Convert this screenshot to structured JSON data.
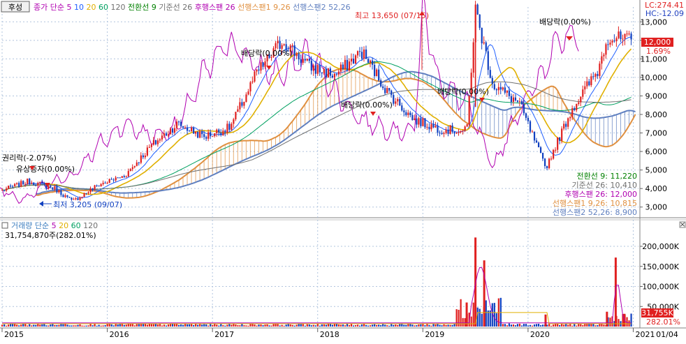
{
  "stock_name": "후성",
  "price_pane": {
    "legend": [
      {
        "text": "종가 단순",
        "color": "#b000b0"
      },
      {
        "text": "5",
        "color": "#b000b0"
      },
      {
        "text": "10",
        "color": "#2060ff"
      },
      {
        "text": "20",
        "color": "#e0b000"
      },
      {
        "text": "60",
        "color": "#00a060"
      },
      {
        "text": "120",
        "color": "#707070"
      },
      {
        "text": "전환선 9",
        "color": "#008000"
      },
      {
        "text": "기준선 26",
        "color": "#707070"
      },
      {
        "text": "후행스팬 26",
        "color": "#b000b0"
      },
      {
        "text": "선행스팬1 9,26",
        "color": "#e09040"
      },
      {
        "text": "선행스팬2 52,26",
        "color": "#6080c0"
      }
    ],
    "lc_text": "LC:274.41",
    "hc_text": "HC:-12.09",
    "price_tag": "12,000",
    "pct_tag": "1.69%",
    "annotations": {
      "high": "최고 13,650 (07/15)",
      "low": "최저 3,205 (09/07)",
      "rights": "권리락(-2.07%)",
      "bonus": "유상증자(0.00%)",
      "div_2017": "배당락(0.00%)",
      "div_2018": "배당락(0.00%)",
      "div_2019": "배당락(0.00%)",
      "div_2020": "배당락(0.00%)"
    },
    "info_box": [
      {
        "text": "전환선 9: 11,220",
        "color": "#008000"
      },
      {
        "text": "기준선 26: 10,410",
        "color": "#707070"
      },
      {
        "text": "후행스팬 26: 12,000",
        "color": "#b000b0"
      },
      {
        "text": "선행스팬1 9,26: 10,815",
        "color": "#e09040"
      },
      {
        "text": "선행스팬2 52,26: 8,900",
        "color": "#6080c0"
      }
    ]
  },
  "volume_pane": {
    "legend": [
      {
        "text": "거래량 단순",
        "color": "#4080c0"
      },
      {
        "text": "5",
        "color": "#b000b0"
      },
      {
        "text": "20",
        "color": "#e0b000"
      },
      {
        "text": "60",
        "color": "#00a060"
      },
      {
        "text": "120",
        "color": "#707070"
      }
    ],
    "last_volume_text": "31,754,870주(282.01%)",
    "vol_tag": "31,755K",
    "vol_pct_tag": "282.01%"
  },
  "x_axis": {
    "years": [
      "2015",
      "2016",
      "2017",
      "2018",
      "2019",
      "2020",
      "2021"
    ],
    "right_label": "01/04"
  },
  "colors": {
    "up": "#e02020",
    "down": "#1040c0",
    "ma5": "#b000b0",
    "ma10": "#2060ff",
    "ma20": "#e0b000",
    "ma60": "#00a060",
    "ma120": "#707070",
    "span1": "#e09040",
    "span2": "#6080c0",
    "grid": "#b0c4de"
  },
  "chart_data": [
    {
      "type": "line",
      "name": "price",
      "x": [
        "2015-01",
        "2015-04",
        "2015-07",
        "2015-09",
        "2015-12",
        "2016-03",
        "2016-06",
        "2016-09",
        "2016-12",
        "2017-03",
        "2017-06",
        "2017-09",
        "2017-12",
        "2018-03",
        "2018-06",
        "2018-09",
        "2018-12",
        "2019-03",
        "2019-06",
        "2019-07",
        "2019-09",
        "2019-12",
        "2020-03",
        "2020-06",
        "2020-09",
        "2020-10",
        "2020-12"
      ],
      "values": [
        3900,
        4400,
        4000,
        3300,
        4200,
        4700,
        6300,
        7500,
        6800,
        7300,
        10200,
        12000,
        10600,
        10100,
        11400,
        9200,
        7700,
        7200,
        7100,
        13650,
        9600,
        8600,
        5100,
        8300,
        10400,
        12200,
        12000
      ],
      "ylim": [
        2500,
        13500
      ],
      "yticks": [
        3000,
        4000,
        5000,
        6000,
        7000,
        8000,
        9000,
        10000,
        11000,
        12000,
        13000
      ],
      "xlabel": "",
      "ylabel": ""
    },
    {
      "type": "bar",
      "name": "volume",
      "x": [
        "2019-06",
        "2019-07",
        "2019-08",
        "2020-03",
        "2020-10",
        "2020-11",
        "2020-12"
      ],
      "values": [
        60000,
        222000,
        165000,
        30000,
        37000,
        172000,
        31755
      ],
      "baseline": 5000,
      "unit": "K",
      "ylim": [
        0,
        240000
      ],
      "yticks": [
        50000,
        100000,
        150000,
        200000
      ]
    }
  ]
}
